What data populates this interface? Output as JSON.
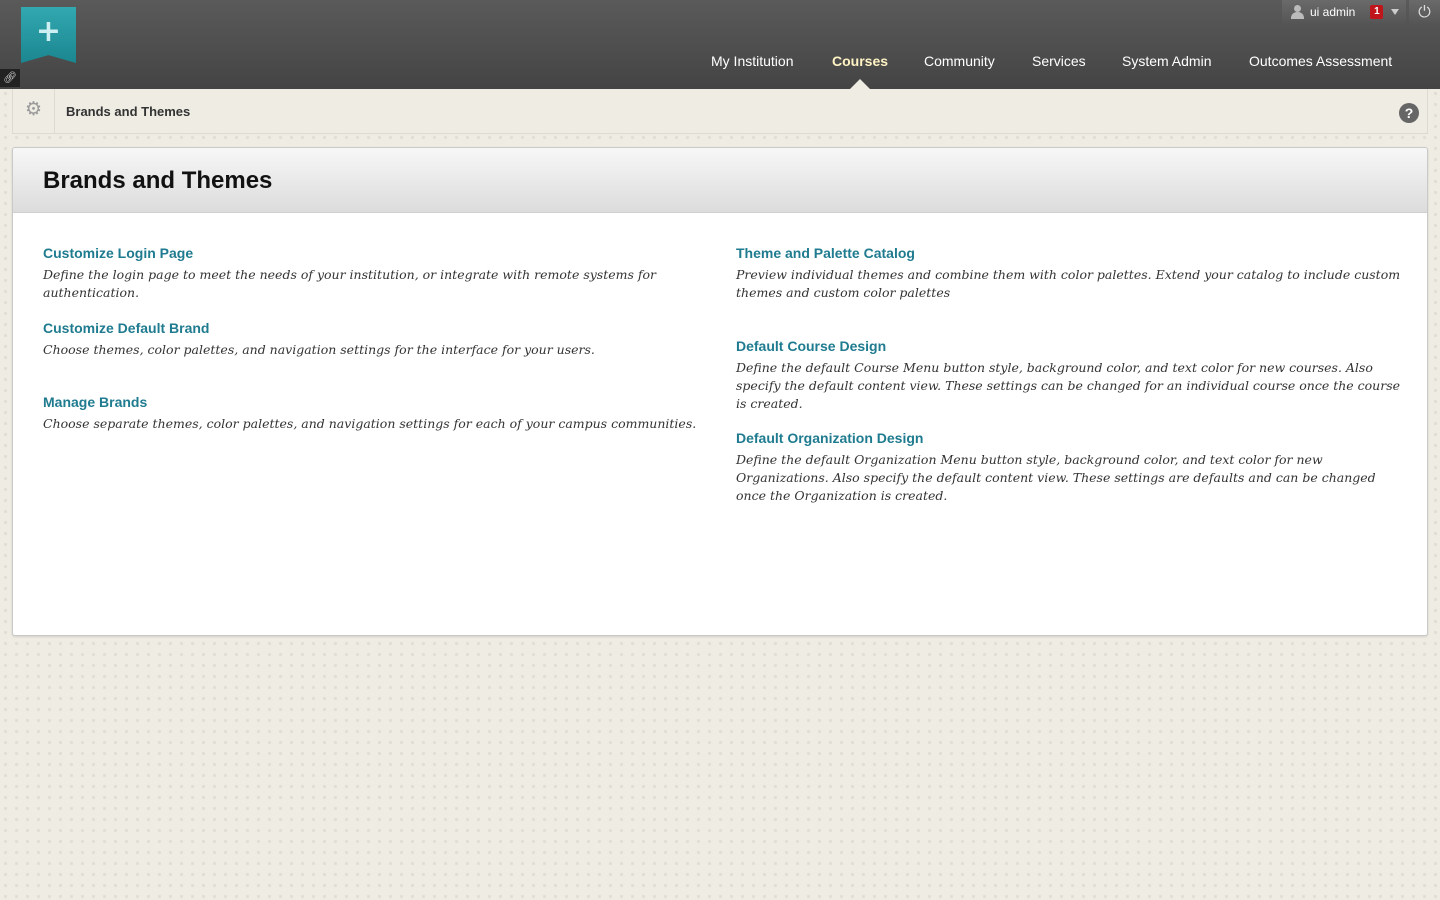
{
  "header": {
    "user_name": "ui admin",
    "notification_count": "1",
    "nav_tabs": [
      {
        "label": "My Institution"
      },
      {
        "label": "Courses"
      },
      {
        "label": "Community"
      },
      {
        "label": "Services"
      },
      {
        "label": "System Admin"
      },
      {
        "label": "Outcomes Assessment"
      }
    ],
    "active_tab": "Courses"
  },
  "breadcrumb": {
    "current": "Brands and Themes"
  },
  "page": {
    "title": "Brands and Themes",
    "left_items": [
      {
        "link": "Customize Login Page",
        "description": "Define the login page to meet the needs of your institution, or integrate with remote systems for authentication."
      },
      {
        "link": "Customize Default Brand",
        "description": "Choose themes, color palettes, and navigation settings for the interface for your users."
      },
      {
        "link": "Manage Brands",
        "description": "Choose separate themes, color palettes, and navigation settings for each of your campus communities."
      }
    ],
    "right_items": [
      {
        "link": "Theme and Palette Catalog",
        "description": "Preview individual themes and combine them with color palettes. Extend your catalog to include custom themes and custom color palettes"
      },
      {
        "link": "Default Course Design",
        "description": "Define the default Course Menu button style, background color, and text color for new courses. Also specify the default content view. These settings can be changed for an individual course once the course is created."
      },
      {
        "link": "Default Organization Design",
        "description": "Define the default Organization Menu button style, background color, and text color for new Organizations. Also specify the default content view. These settings are defaults and can be changed once the Organization is created."
      }
    ]
  },
  "colors": {
    "link": "#1f7b8f",
    "header_bg": "#4f4f4f",
    "active_tab": "#fff3c4",
    "logo": "#27a0a8",
    "badge": "#c0161b"
  }
}
